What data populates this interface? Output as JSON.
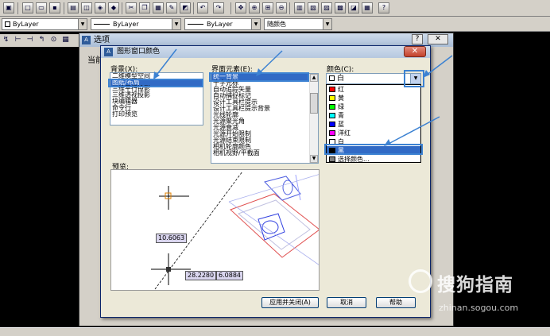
{
  "toolbar": {
    "layer_combo": "ByLayer",
    "linetype_combo": "ByLayer",
    "lineweight_combo": "ByLayer",
    "color_combo": "随颜色"
  },
  "options_window": {
    "title": "选项",
    "tab_partial": "当前",
    "help_button": "?",
    "close_button": "✕"
  },
  "dialog": {
    "title": "图形窗口颜色",
    "close_button": "✕",
    "context_label": "背景(X):",
    "context_items": [
      "二维模型空间",
      "图纸/布局",
      "三维平行投影",
      "三维透视投影",
      "块编辑器",
      "命令行",
      "打印预览"
    ],
    "context_selected": 1,
    "element_label": "界面元素(E):",
    "element_items": [
      "统一背景",
      "十字光标",
      "自动追踪矢量",
      "自动捕捉标记",
      "设计工具栏提示",
      "设计工具栏提示背景",
      "光线轮廓",
      "光源聚光角",
      "光源衰减",
      "光源开始限制",
      "光源结束限制",
      "相机轮廓颜色",
      "相机视野/平截面"
    ],
    "element_selected": 0,
    "color_label": "颜色(C):",
    "color_current": "白",
    "color_options": [
      {
        "name": "红",
        "hex": "#ff0000"
      },
      {
        "name": "黄",
        "hex": "#ffff00"
      },
      {
        "name": "绿",
        "hex": "#00ff00"
      },
      {
        "name": "青",
        "hex": "#00ffff"
      },
      {
        "name": "蓝",
        "hex": "#0000ff"
      },
      {
        "name": "洋红",
        "hex": "#ff00ff"
      },
      {
        "name": "白",
        "hex": "#ffffff"
      },
      {
        "name": "黑",
        "hex": "#000000"
      },
      {
        "name": "选择颜色...",
        "hex": "#808080"
      }
    ],
    "color_selected": 7,
    "preview_label": "预览:",
    "preview_coords": {
      "a": "10.6063",
      "b": "28.2280",
      "c": "6.0884"
    },
    "apply_close_button": "应用并关闭(A)",
    "cancel_button": "取消",
    "help_button": "帮助"
  },
  "watermark": {
    "brand": "搜狗指南",
    "url": "zhinan.sogou.com"
  },
  "colors": {
    "selection": "#316ac5",
    "highlight": "#3c82d2",
    "close_red": "#c3412b"
  }
}
